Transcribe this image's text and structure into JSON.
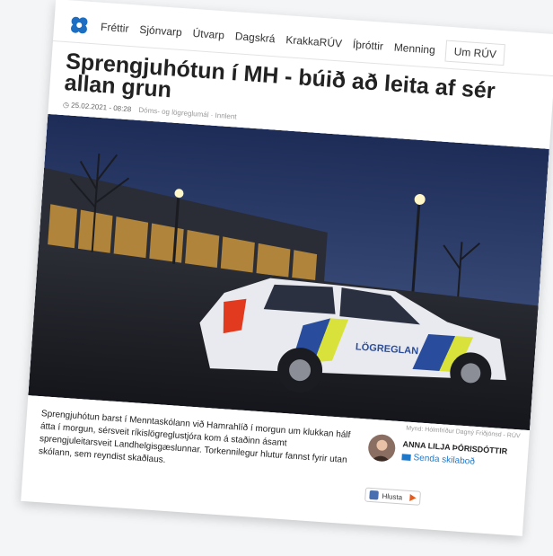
{
  "nav": {
    "items": [
      "Fréttir",
      "Sjónvarp",
      "Útvarp",
      "Dagskrá",
      "KrakkaRÚV",
      "Íþróttir",
      "Menning",
      "Um RÚV"
    ]
  },
  "article": {
    "headline": "Sprengjuhótun í MH - búið að leita af sér allan grun",
    "date": "25.02.2021 - 08:28",
    "category": "Dóms- og lögreglumál · Innlent",
    "photo_credit": "Mynd: Hólmfríður Dagný Friðjónsd - RÚV",
    "car_label": "LÖGREGLAN",
    "body": "Sprengjuhótun barst í Menntaskólann við Hamrahlíð í morgun um klukkan hálf átta í morgun, sérsveit ríkislögreglustjóra kom á staðinn ásamt sprengjuleitarsveit Landhelgisgæslunnar. Torkennilegur hlutur fannst fyrir utan skólann, sem reyndist skaðlaus."
  },
  "author": {
    "name": "ANNA LILJA ÞÓRISDÓTTIR",
    "message_link": "Senda skilaboð"
  },
  "listen": {
    "label": "Hlusta"
  },
  "colors": {
    "brand": "#1b6ec2",
    "link": "#1f78c8",
    "play": "#e85a1a"
  }
}
